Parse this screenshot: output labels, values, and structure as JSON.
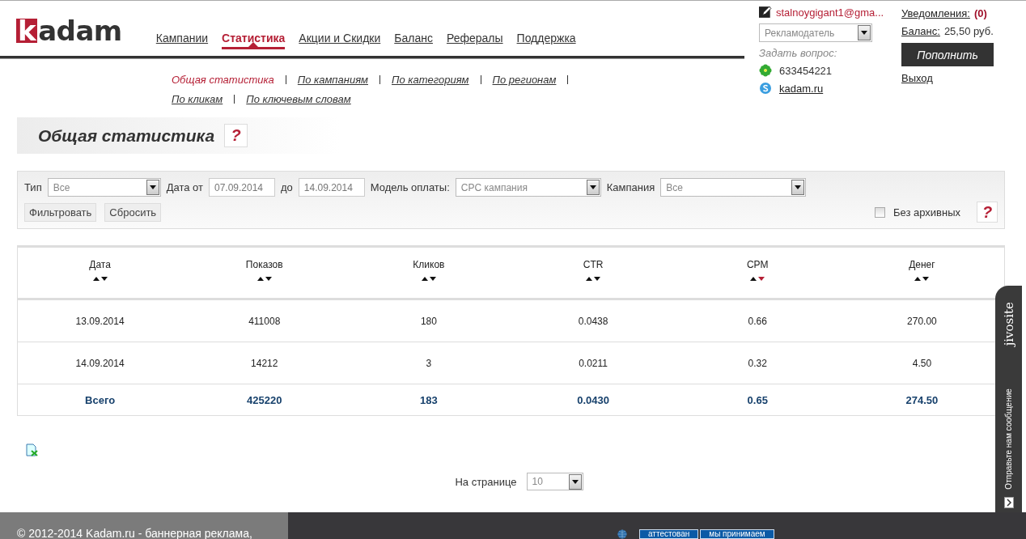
{
  "logo": {
    "text": "kadam"
  },
  "nav": [
    {
      "label": "Кампании",
      "selected": false
    },
    {
      "label": "Статистика",
      "selected": true
    },
    {
      "label": "Акции и Скидки",
      "selected": false
    },
    {
      "label": "Баланс",
      "selected": false
    },
    {
      "label": "Рефералы",
      "selected": false
    },
    {
      "label": "Поддержка",
      "selected": false
    }
  ],
  "subnav": [
    {
      "label": "Общая статистика",
      "selected": true
    },
    {
      "label": "По кампаниям",
      "selected": false
    },
    {
      "label": "По категориям",
      "selected": false
    },
    {
      "label": "По регионам",
      "selected": false
    },
    {
      "label": "По кликам",
      "selected": false
    },
    {
      "label": "По ключевым словам",
      "selected": false
    }
  ],
  "account": {
    "email": "stalnoygigant1@gma...",
    "role": "Рекламодатель",
    "ask": "Задать вопрос:",
    "icq": "633454221",
    "skype": "kadam.ru",
    "notifications_label": "Уведомления:",
    "notifications_count": "(0)",
    "balance_label": "Баланс:",
    "balance_value": "25,50 руб.",
    "topup": "Пополнить",
    "logout": "Выход"
  },
  "page_title": "Общая статистика",
  "help": "?",
  "filters": {
    "type_label": "Тип",
    "type_value": "Все",
    "date_from_label": "Дата от",
    "date_from": "07.09.2014",
    "date_to_label": "до",
    "date_to": "14.09.2014",
    "model_label": "Модель оплаты:",
    "model_value": "CPC кампания",
    "campaign_label": "Кампания",
    "campaign_value": "Все",
    "filter_button": "Фильтровать",
    "reset_button": "Сбросить",
    "no_archive_label": "Без архивных",
    "no_archive_checked": false,
    "help": "?"
  },
  "table": {
    "columns": [
      {
        "label": "Дата",
        "sorted_desc": false
      },
      {
        "label": "Показов",
        "sorted_desc": false
      },
      {
        "label": "Кликов",
        "sorted_desc": false
      },
      {
        "label": "CTR",
        "sorted_desc": false
      },
      {
        "label": "CPM",
        "sorted_desc": true
      },
      {
        "label": "Денег",
        "sorted_desc": false
      }
    ],
    "rows": [
      [
        "13.09.2014",
        "411008",
        "180",
        "0.0438",
        "0.66",
        "270.00"
      ],
      [
        "14.09.2014",
        "14212",
        "3",
        "0.0211",
        "0.32",
        "4.50"
      ]
    ],
    "total": [
      "Всего",
      "425220",
      "183",
      "0.0430",
      "0.65",
      "274.50"
    ]
  },
  "per_page": {
    "label": "На странице",
    "value": "10"
  },
  "footer": {
    "copyright": "© 2012-2014 Kadam.ru - баннерная реклама,",
    "badges": [
      "аттестован",
      "мы принимаем"
    ]
  },
  "chat": {
    "brand": "jivosite",
    "text": "Отправьте нам сообщение"
  }
}
